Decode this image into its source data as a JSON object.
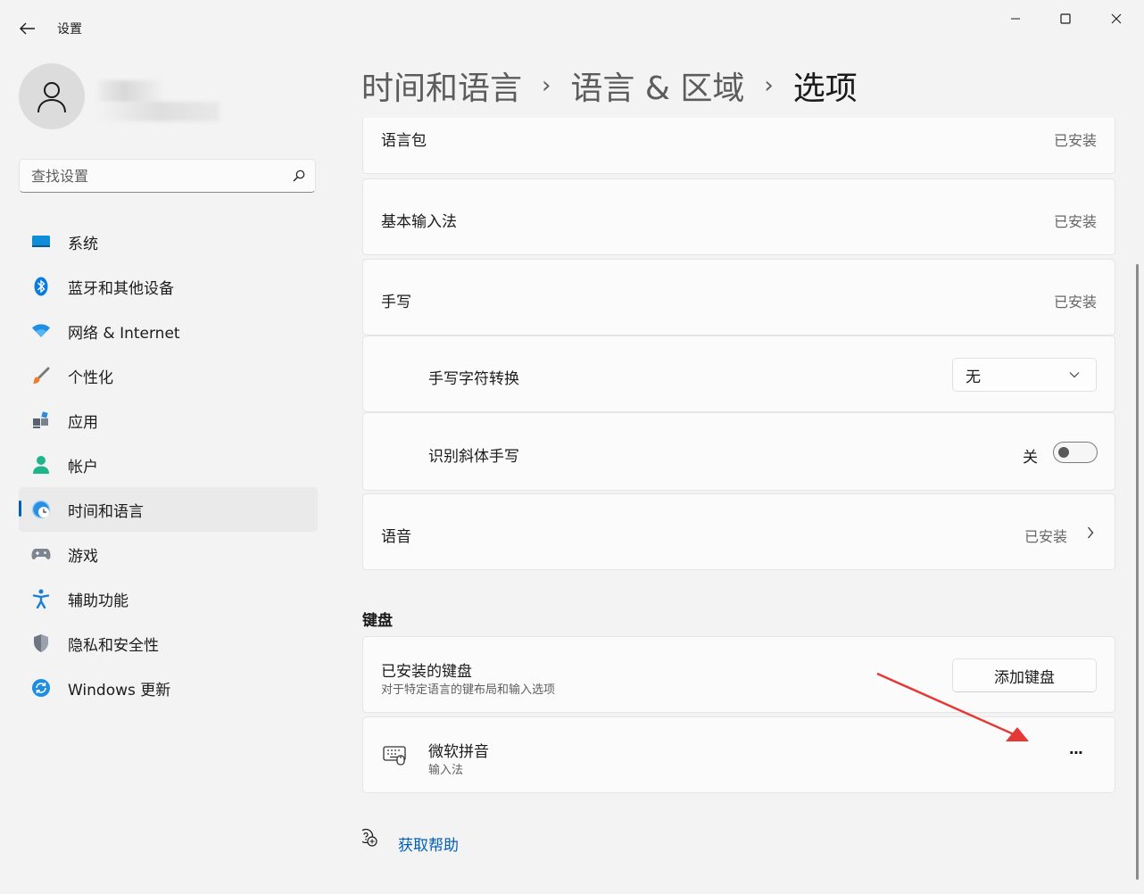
{
  "window": {
    "title": "设置"
  },
  "sidebar": {
    "search_placeholder": "查找设置",
    "items": [
      {
        "label": "系统",
        "icon": "monitor-icon"
      },
      {
        "label": "蓝牙和其他设备",
        "icon": "bluetooth-icon"
      },
      {
        "label": "网络 & Internet",
        "icon": "wifi-icon"
      },
      {
        "label": "个性化",
        "icon": "brush-icon"
      },
      {
        "label": "应用",
        "icon": "apps-icon"
      },
      {
        "label": "帐户",
        "icon": "account-icon"
      },
      {
        "label": "时间和语言",
        "icon": "globe-clock-icon",
        "active": true
      },
      {
        "label": "游戏",
        "icon": "gamepad-icon"
      },
      {
        "label": "辅助功能",
        "icon": "accessibility-icon"
      },
      {
        "label": "隐私和安全性",
        "icon": "shield-icon"
      },
      {
        "label": "Windows 更新",
        "icon": "update-icon"
      }
    ]
  },
  "breadcrumb": {
    "level1": "时间和语言",
    "level2": "语言 & 区域",
    "current": "选项",
    "separator": "›"
  },
  "language_features": {
    "language_pack": {
      "label": "语言包",
      "status": "已安装"
    },
    "basic_input": {
      "label": "基本输入法",
      "status": "已安装"
    },
    "handwriting": {
      "label": "手写",
      "status": "已安装"
    },
    "handwriting_conversion": {
      "label": "手写字符转换",
      "selected": "无"
    },
    "italic_handwriting": {
      "label": "识别斜体手写",
      "state_label": "关",
      "on": false
    },
    "speech": {
      "label": "语音",
      "status": "已安装"
    }
  },
  "keyboard": {
    "section_title": "键盘",
    "installed": {
      "label": "已安装的键盘",
      "description": "对于特定语言的键布局和输入选项",
      "add_button": "添加键盘"
    },
    "items": [
      {
        "name": "微软拼音",
        "type": "输入法",
        "more": "···"
      }
    ]
  },
  "help": {
    "label": "获取帮助"
  },
  "colors": {
    "accent": "#005fb8",
    "background": "#f3f3f3",
    "card": "#fbfbfb",
    "arrow": "#e53935"
  }
}
